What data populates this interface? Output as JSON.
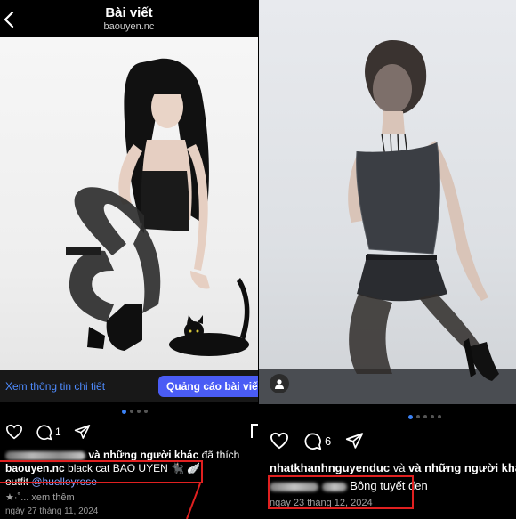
{
  "left_post": {
    "header": {
      "title": "Bài viết",
      "username": "baouyen.nc"
    },
    "info_link": "Xem thông tin chi tiết",
    "ad_button": "Quảng cáo bài viết",
    "comment_count": "1",
    "likes_text": "và những người khác",
    "liked_word": "đã thích",
    "caption_user": "baouyen.nc",
    "caption_text": "black cat BAO UYEN 🐈‍⬛ 🪽",
    "caption_text2": "outfit",
    "caption_mention": "@huelleyrose",
    "caption_more_prefix": "★·˚...",
    "caption_more": "xem thêm",
    "date": "ngày 27 tháng 11, 2024"
  },
  "right_post": {
    "comment_count": "6",
    "liker": "nhatkhanhnguyenduc",
    "likes_text": "và những người khác",
    "likes_trunc": "c",
    "caption_text": "Bông tuyết đen",
    "date": "ngày 23 tháng 12, 2024"
  },
  "colors": {
    "accent_blue": "#4a5cf5",
    "link_blue": "#4f8cff",
    "highlight_red": "#e02020"
  },
  "icons": [
    "back-chevron-icon",
    "heart-icon",
    "comment-icon",
    "share-icon",
    "person-icon"
  ]
}
